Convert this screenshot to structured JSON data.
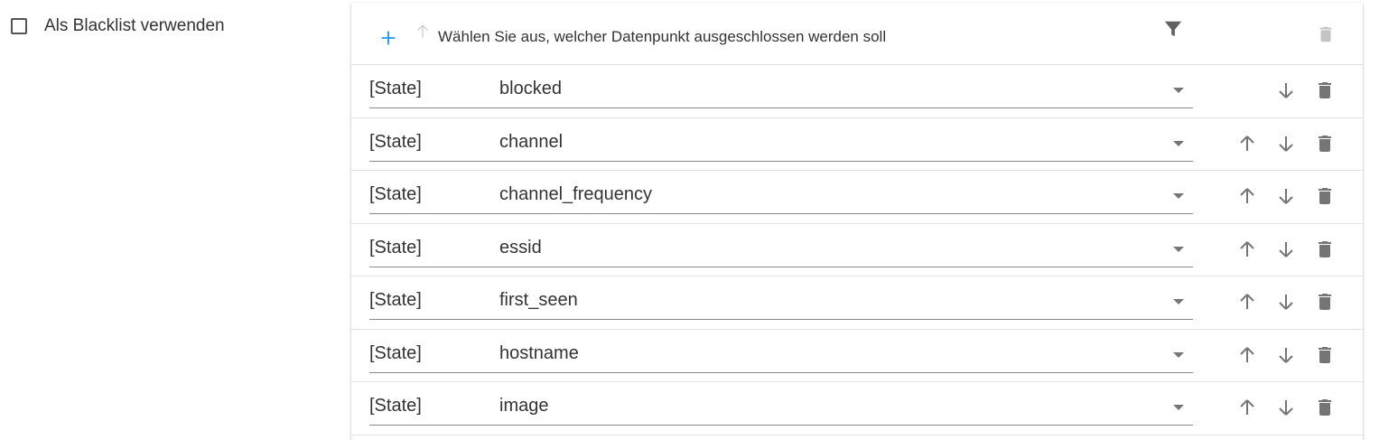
{
  "blacklist": {
    "label": "Als Blacklist verwenden",
    "checked": false
  },
  "table": {
    "header": {
      "text": "Wählen Sie aus, welcher Datenpunkt ausgeschlossen werden soll",
      "add_icon": "plus-icon",
      "sort_icon": "arrow-up-icon",
      "filter_icon": "filter-icon",
      "delete_all_icon": "trash-icon"
    },
    "rows": [
      {
        "type": "[State]",
        "value": "blocked"
      },
      {
        "type": "[State]",
        "value": "channel"
      },
      {
        "type": "[State]",
        "value": "channel_frequency"
      },
      {
        "type": "[State]",
        "value": "essid"
      },
      {
        "type": "[State]",
        "value": "first_seen"
      },
      {
        "type": "[State]",
        "value": "hostname"
      },
      {
        "type": "[State]",
        "value": "image"
      }
    ],
    "row_icons": {
      "up": "arrow-up-icon",
      "down": "arrow-down-icon",
      "delete": "trash-icon"
    }
  },
  "colors": {
    "accent": "#2196f3",
    "icon": "#757575",
    "icon_disabled": "#c4c4c4",
    "text": "#333333"
  }
}
